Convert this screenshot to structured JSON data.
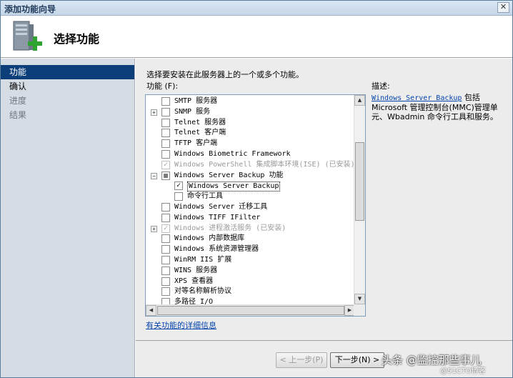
{
  "window": {
    "title": "添加功能向导",
    "close_glyph": "✕"
  },
  "header": {
    "title": "选择功能",
    "icon": "server-add-icon"
  },
  "sidebar": {
    "items": [
      {
        "label": "功能",
        "state": "active"
      },
      {
        "label": "确认",
        "state": "normal"
      },
      {
        "label": "进度",
        "state": "disabled"
      },
      {
        "label": "结果",
        "state": "disabled"
      }
    ]
  },
  "main": {
    "instruction": "选择要安装在此服务器上的一个或多个功能。",
    "features_label": "功能 (F):",
    "description_label": "描述:",
    "description_link": "Windows Server Backup",
    "description_text": " 包括 Microsoft 管理控制台(MMC)管理单元、Wbadmin 命令行工具和服务。",
    "more_info_link": "有关功能的详细信息"
  },
  "features": [
    {
      "label": "SMTP 服务器",
      "checked": false,
      "disabled": false,
      "expander": ""
    },
    {
      "label": "SNMP 服务",
      "checked": false,
      "disabled": false,
      "expander": "+"
    },
    {
      "label": "Telnet 服务器",
      "checked": false,
      "disabled": false,
      "expander": ""
    },
    {
      "label": "Telnet 客户端",
      "checked": false,
      "disabled": false,
      "expander": ""
    },
    {
      "label": "TFTP 客户端",
      "checked": false,
      "disabled": false,
      "expander": ""
    },
    {
      "label": "Windows Biometric Framework",
      "checked": false,
      "disabled": false,
      "expander": ""
    },
    {
      "label": "Windows PowerShell 集成脚本环境(ISE)  (已安装)",
      "checked": true,
      "disabled": true,
      "expander": ""
    },
    {
      "label": "Windows Server Backup 功能",
      "checked": "partial",
      "disabled": false,
      "expander": "−"
    },
    {
      "label": "Windows Server Backup",
      "checked": true,
      "disabled": false,
      "expander": "",
      "child": true,
      "selected": true
    },
    {
      "label": "命令行工具",
      "checked": false,
      "disabled": false,
      "expander": "",
      "child": true
    },
    {
      "label": "Windows Server 迁移工具",
      "checked": false,
      "disabled": false,
      "expander": ""
    },
    {
      "label": "Windows TIFF IFilter",
      "checked": false,
      "disabled": false,
      "expander": ""
    },
    {
      "label": "Windows 进程激活服务  (已安装)",
      "checked": true,
      "disabled": true,
      "expander": "+"
    },
    {
      "label": "Windows 内部数据库",
      "checked": false,
      "disabled": false,
      "expander": ""
    },
    {
      "label": "Windows 系统资源管理器",
      "checked": false,
      "disabled": false,
      "expander": ""
    },
    {
      "label": "WinRM IIS 扩展",
      "checked": false,
      "disabled": false,
      "expander": ""
    },
    {
      "label": "WINS 服务器",
      "checked": false,
      "disabled": false,
      "expander": ""
    },
    {
      "label": "XPS 查看器",
      "checked": false,
      "disabled": false,
      "expander": ""
    },
    {
      "label": "对等名称解析协议",
      "checked": false,
      "disabled": false,
      "expander": ""
    },
    {
      "label": "多路径 I/O",
      "checked": false,
      "disabled": false,
      "expander": ""
    }
  ],
  "footer": {
    "prev_label": "< 上一步(P)",
    "next_label": "下一步(N) >",
    "watermark": "头条 @监控那些事儿",
    "watermark_small": "@51CTO博客"
  }
}
